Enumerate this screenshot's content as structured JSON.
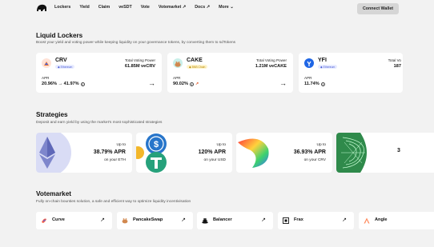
{
  "nav": {
    "links": [
      "Lockers",
      "Yield",
      "Claim",
      "veSDT",
      "Vote",
      "Votemarket ↗",
      "Docs ↗",
      "More ⌄"
    ],
    "connect_label": "Connect Wallet"
  },
  "lockers": {
    "title": "Liquid Lockers",
    "subtitle": "Boost your yield and voting power while keeping liquidity on your governance tokens, by converting them to sdTokens",
    "cards": [
      {
        "name": "CRV",
        "chain": "Ethereum",
        "tvp_label": "Total Voting Power",
        "tvp_value": "61.85M veCRV",
        "apr_label": "APR",
        "apr_value": "20.96% → 41.97%"
      },
      {
        "name": "CAKE",
        "chain": "BNB Chain",
        "tvp_label": "Total Voting Power",
        "tvp_value": "1.21M veCAKE",
        "apr_label": "APR",
        "apr_value": "90.02%"
      },
      {
        "name": "YFI",
        "chain": "Ethereum",
        "tvp_label": "Total Vo",
        "tvp_value": "187",
        "apr_label": "APR",
        "apr_value": "11.74%"
      }
    ]
  },
  "strategies": {
    "title": "Strategies",
    "subtitle": "Deposit and earn yield by using the market's most sophisticated strategies",
    "cards": [
      {
        "upto": "Up to",
        "apr": "38.79% APR",
        "on": "on your ETH"
      },
      {
        "upto": "Up to",
        "apr": "120% APR",
        "on": "on your USD"
      },
      {
        "upto": "Up to",
        "apr": "36.93% APR",
        "on": "on your CRV"
      },
      {
        "upto": "",
        "apr": "3",
        "on": ""
      }
    ]
  },
  "votemarket": {
    "title": "Votemarket",
    "subtitle": "Fully on-chain bounties solution, a safe and efficient way to optimize liquidity incentivisation",
    "items": [
      {
        "name": "Curve",
        "arrow": "↗"
      },
      {
        "name": "PancakeSwap",
        "arrow": "↗"
      },
      {
        "name": "Balancer",
        "arrow": "↗"
      },
      {
        "name": "Frax",
        "arrow": "↗"
      },
      {
        "name": "Angle",
        "arrow": ""
      }
    ]
  },
  "colors": {
    "accent": "#111111",
    "button": "#d6d6d6",
    "eth_badge": "#e8ecff",
    "bnb_badge": "#fff4cc"
  }
}
